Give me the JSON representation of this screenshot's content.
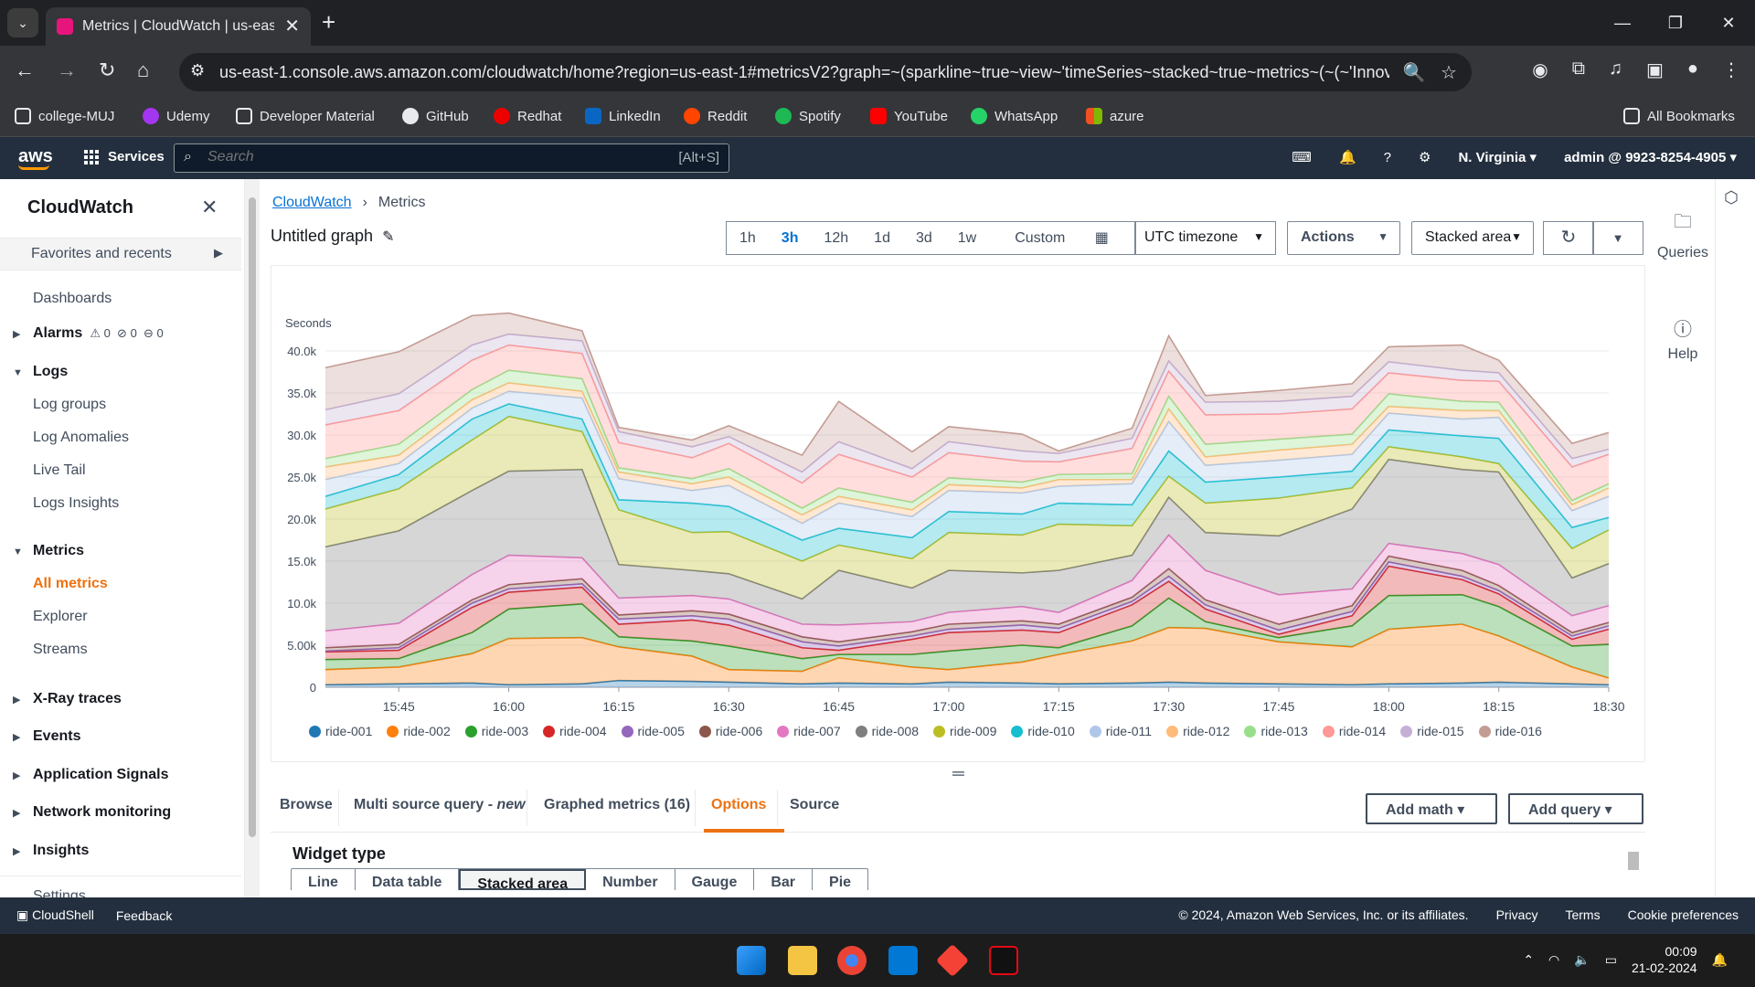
{
  "browser": {
    "tab_title": "Metrics | CloudWatch | us-east-",
    "url": "us-east-1.console.aws.amazon.com/cloudwatch/home?region=us-east-1#metricsV2?graph=~(sparkline~true~view~'timeSeries~stacked~true~metrics~(~(~'Innova...",
    "bookmarks": [
      "college-MUJ",
      "Udemy",
      "Developer Material",
      "GitHub",
      "Redhat",
      "LinkedIn",
      "Reddit",
      "Spotify",
      "YouTube",
      "WhatsApp",
      "azure"
    ],
    "all_bookmarks": "All Bookmarks"
  },
  "aws_nav": {
    "logo": "aws",
    "services": "Services",
    "search_placeholder": "Search",
    "search_hint": "[Alt+S]",
    "region": "N. Virginia",
    "account": "admin @ 9923-8254-4905"
  },
  "sidebar": {
    "title": "CloudWatch",
    "favorites": "Favorites and recents",
    "dashboards": "Dashboards",
    "alarms": "Alarms",
    "alarm_counts": [
      "0",
      "0",
      "0"
    ],
    "logs": "Logs",
    "log_items": [
      "Log groups",
      "Log Anomalies",
      "Live Tail",
      "Logs Insights"
    ],
    "metrics": "Metrics",
    "metric_items": [
      "All metrics",
      "Explorer",
      "Streams"
    ],
    "sections": [
      "X-Ray traces",
      "Events",
      "Application Signals",
      "Network monitoring",
      "Insights"
    ],
    "settings": "Settings"
  },
  "main": {
    "breadcrumb": [
      "CloudWatch",
      "Metrics"
    ],
    "graph_title": "Untitled graph",
    "time_ranges": [
      "1h",
      "3h",
      "12h",
      "1d",
      "3d",
      "1w"
    ],
    "selected_range": "3h",
    "custom": "Custom",
    "timezone": "UTC timezone",
    "actions": "Actions",
    "view": "Stacked area",
    "tabs": [
      "Browse",
      "Multi source query - ",
      "new",
      "Graphed metrics (16)",
      "Options",
      "Source"
    ],
    "active_tab": "Options",
    "add_math": "Add math",
    "add_query": "Add query",
    "widget_type_label": "Widget type",
    "widget_types": [
      "Line",
      "Data table",
      "Stacked area",
      "Number",
      "Gauge",
      "Bar",
      "Pie"
    ],
    "selected_widget": "Stacked area"
  },
  "right_rail": {
    "queries": "Queries",
    "help": "Help"
  },
  "footer": {
    "cloudshell": "CloudShell",
    "feedback": "Feedback",
    "copyright": "© 2024, Amazon Web Services, Inc. or its affiliates.",
    "links": [
      "Privacy",
      "Terms",
      "Cookie preferences"
    ]
  },
  "taskbar": {
    "time": "00:09",
    "date": "21-02-2024"
  },
  "chart_data": {
    "type": "area",
    "stacked": true,
    "ylabel": "Seconds",
    "ylim": [
      0,
      40000
    ],
    "yticks": [
      "0",
      "5.00k",
      "10.0k",
      "15.0k",
      "20.0k",
      "25.0k",
      "30.0k",
      "35.0k",
      "40.0k"
    ],
    "x": [
      "15:35",
      "15:45",
      "15:55",
      "16:00",
      "16:10",
      "16:15",
      "16:25",
      "16:30",
      "16:40",
      "16:45",
      "16:55",
      "17:00",
      "17:10",
      "17:15",
      "17:25",
      "17:30",
      "17:35",
      "17:45",
      "17:55",
      "18:00",
      "18:10",
      "18:15",
      "18:25",
      "18:30"
    ],
    "x_tick_labels": [
      "15:45",
      "16:00",
      "16:15",
      "16:30",
      "16:45",
      "17:00",
      "17:15",
      "17:30",
      "17:45",
      "18:00",
      "18:15",
      "18:30"
    ],
    "series": [
      {
        "name": "ride-001",
        "color": "#1f77b4",
        "values": [
          300,
          400,
          500,
          300,
          400,
          800,
          700,
          600,
          400,
          500,
          400,
          600,
          500,
          400,
          500,
          600,
          500,
          400,
          300,
          400,
          500,
          600,
          400,
          300
        ]
      },
      {
        "name": "ride-002",
        "color": "#ff7f0e",
        "values": [
          1800,
          2000,
          3500,
          5500,
          5500,
          4000,
          3000,
          1500,
          1500,
          3000,
          2000,
          1500,
          2500,
          3500,
          5000,
          6500,
          6500,
          5000,
          4500,
          6500,
          7000,
          5500,
          2000,
          800
        ]
      },
      {
        "name": "ride-003",
        "color": "#2ca02c",
        "values": [
          1200,
          1000,
          2500,
          3500,
          4000,
          1200,
          1800,
          2800,
          1500,
          400,
          1500,
          2200,
          2000,
          800,
          1800,
          3500,
          800,
          500,
          2500,
          4000,
          3500,
          3500,
          2500,
          4000
        ]
      },
      {
        "name": "ride-004",
        "color": "#d62728",
        "values": [
          900,
          1000,
          3000,
          2000,
          2000,
          1500,
          2500,
          2500,
          1300,
          500,
          1800,
          2200,
          1800,
          1800,
          2500,
          2000,
          1500,
          400,
          1200,
          3500,
          1800,
          1500,
          800,
          1800
        ]
      },
      {
        "name": "ride-005",
        "color": "#9467bd",
        "values": [
          100,
          300,
          500,
          400,
          400,
          600,
          500,
          700,
          700,
          500,
          400,
          400,
          600,
          500,
          400,
          600,
          500,
          500,
          500,
          500,
          400,
          400,
          400,
          400
        ]
      },
      {
        "name": "ride-006",
        "color": "#8c564b",
        "values": [
          400,
          400,
          400,
          500,
          600,
          500,
          600,
          600,
          600,
          500,
          500,
          600,
          500,
          500,
          500,
          900,
          600,
          700,
          700,
          700,
          700,
          600,
          400,
          400
        ]
      },
      {
        "name": "ride-007",
        "color": "#e377c2",
        "values": [
          2000,
          2500,
          3000,
          3500,
          2500,
          2000,
          1800,
          1800,
          1500,
          2000,
          1200,
          1400,
          1700,
          1400,
          2000,
          4000,
          3500,
          3500,
          2000,
          1500,
          2000,
          2500,
          2000,
          2000
        ]
      },
      {
        "name": "ride-008",
        "color": "#7f7f7f",
        "values": [
          10000,
          11000,
          10000,
          10000,
          10500,
          4000,
          3000,
          3000,
          3000,
          6500,
          4000,
          5000,
          4000,
          5000,
          3000,
          4500,
          4500,
          7000,
          9500,
          10000,
          10000,
          11000,
          4500,
          5000
        ]
      },
      {
        "name": "ride-009",
        "color": "#bcbd22",
        "values": [
          4500,
          5000,
          6000,
          6500,
          4500,
          6500,
          4500,
          5000,
          4500,
          3000,
          3500,
          4500,
          4500,
          5500,
          3500,
          2500,
          3500,
          4500,
          2500,
          1500,
          1500,
          1000,
          3500,
          4000
        ]
      },
      {
        "name": "ride-010",
        "color": "#17becf",
        "values": [
          1500,
          1700,
          2500,
          1500,
          1500,
          1200,
          3500,
          3000,
          2500,
          2000,
          2500,
          2500,
          2500,
          2500,
          2500,
          3000,
          2500,
          2500,
          2000,
          2000,
          2500,
          3000,
          2500,
          1500
        ]
      },
      {
        "name": "ride-011",
        "color": "#aec7e8",
        "values": [
          2000,
          1300,
          1300,
          1500,
          2500,
          2500,
          1500,
          2500,
          2000,
          3000,
          2500,
          2500,
          2500,
          2000,
          2500,
          3500,
          2000,
          2000,
          2000,
          2000,
          2000,
          2500,
          2000,
          2500
        ]
      },
      {
        "name": "ride-012",
        "color": "#ffbb78",
        "values": [
          1500,
          1000,
          1000,
          1000,
          800,
          800,
          800,
          1000,
          1000,
          800,
          800,
          700,
          600,
          800,
          500,
          1500,
          1000,
          1200,
          1200,
          800,
          1000,
          800,
          700,
          1000
        ]
      },
      {
        "name": "ride-013",
        "color": "#98df8a",
        "values": [
          1000,
          1300,
          1200,
          1500,
          1500,
          500,
          600,
          1000,
          800,
          1000,
          900,
          800,
          700,
          600,
          700,
          1500,
          1500,
          1300,
          1200,
          1500,
          1100,
          1000,
          500,
          500
        ]
      },
      {
        "name": "ride-014",
        "color": "#ff9896",
        "values": [
          4000,
          4000,
          3500,
          3000,
          3000,
          3000,
          2500,
          3000,
          3000,
          4000,
          3000,
          3000,
          2500,
          1500,
          3000,
          3000,
          3500,
          3000,
          3000,
          2500,
          2500,
          2500,
          4000,
          3500
        ]
      },
      {
        "name": "ride-015",
        "color": "#c5b0d5",
        "values": [
          1800,
          2000,
          1800,
          1300,
          1500,
          1300,
          1300,
          800,
          1300,
          1500,
          1000,
          1300,
          1200,
          1000,
          1200,
          1200,
          1500,
          1500,
          1500,
          1300,
          1200,
          1000,
          1000,
          600
        ]
      },
      {
        "name": "ride-016",
        "color": "#c49c94",
        "values": [
          5000,
          5000,
          3500,
          2500,
          1200,
          500,
          800,
          1300,
          2000,
          4800,
          2000,
          1800,
          2000,
          300,
          1200,
          3000,
          800,
          1300,
          1500,
          1800,
          3000,
          1500,
          1800,
          2000
        ]
      }
    ]
  }
}
